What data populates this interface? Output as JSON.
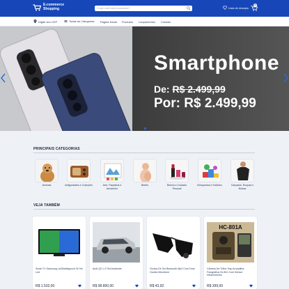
{
  "header": {
    "logo_line1": "E-commerce",
    "logo_line2": "Shopping",
    "search_placeholder": "O que você está procurando?",
    "wishlist_label": "Lista de desejos",
    "cart_count": "0"
  },
  "nav": {
    "cep_label": "Digite seu CEP",
    "categories_label": "Todas as Categorias",
    "links": [
      "Página Inicial",
      "Produtos",
      "Lançamentos",
      "Contato"
    ]
  },
  "hero": {
    "title": "Smartphone",
    "from_label": "De:",
    "old_price": "R$ 2.499,99",
    "now_label": "Por: R$ 2.499,99"
  },
  "categories": {
    "title": "PRINCIPAIS CATEGORIAS",
    "items": [
      {
        "label": "Animais"
      },
      {
        "label": "Antiguidades e Coleções"
      },
      {
        "label": "Arte, Papelaria e Armarinho"
      },
      {
        "label": "Bebês"
      },
      {
        "label": "Beleza e Cuidado Pessoal"
      },
      {
        "label": "Brinquedos e Hobbies"
      },
      {
        "label": "Calçados, Roupas e Bolsas"
      }
    ]
  },
  "see_also": {
    "title": "VEJA TAMBÉM",
    "products": [
      {
        "name": "Smart Tv Samsung Ls32betblppxzd 32 Hd Led",
        "price": "R$ 1.532,00"
      },
      {
        "name": "Audi Q3 1.4 Tfsi Ambiente",
        "price": "R$ 98.800,00"
      },
      {
        "name": "Óculos De Sol Bluetooth Mp3 Com Fone Ouvido Microfone",
        "price": "R$ 43,92"
      },
      {
        "name": "Câmera De Trilha Trap Armadilha Fotográfica Hc 801 Com Sensor Infravermelho",
        "price": "R$ 399,00"
      }
    ]
  },
  "colors": {
    "brand": "#1746b8",
    "accent": "#2a6ad6"
  }
}
